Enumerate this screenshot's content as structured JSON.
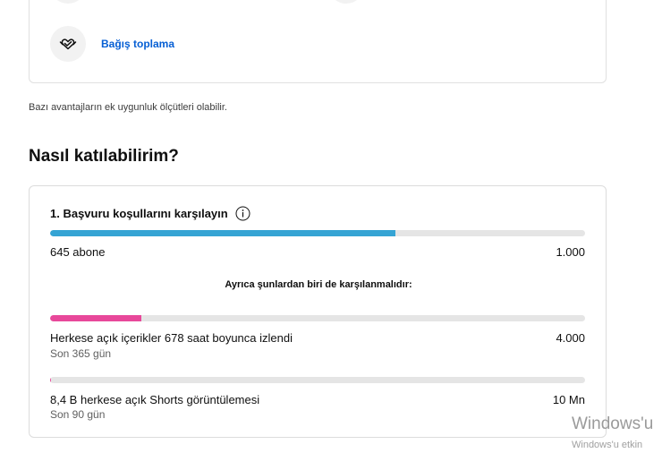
{
  "benefits": {
    "items": [
      {
        "label": "Bağış toplama",
        "icon": "fundraising-hands-heart-icon"
      }
    ]
  },
  "eligibility_note": "Bazı avantajların ek uygunluk ölçütleri olabilir.",
  "section_title": "Nasıl katılabilirim?",
  "requirements": {
    "title": "1. Başvuru koşullarını karşılayın",
    "subscribers": {
      "current_label": "645 abone",
      "target_label": "1.000",
      "progress": 0.645,
      "color": "#35a4d4"
    },
    "also_note": "Ayrıca şunlardan biri de karşılanmalıdır:",
    "watch_hours": {
      "current_label": "Herkese açık içerikler 678 saat boyunca izlendi",
      "target_label": "4.000",
      "period": "Son 365 gün",
      "progress": 0.17,
      "color": "#e8489a"
    },
    "shorts_views": {
      "current_label": "8,4 B herkese açık Shorts görüntülemesi",
      "target_label": "10 Mn",
      "period": "Son 90 gün",
      "progress": 0.00084,
      "color": "#e8489a"
    }
  },
  "watermark": {
    "line1": "Windows'u",
    "line2": "Windows'u etkin"
  }
}
